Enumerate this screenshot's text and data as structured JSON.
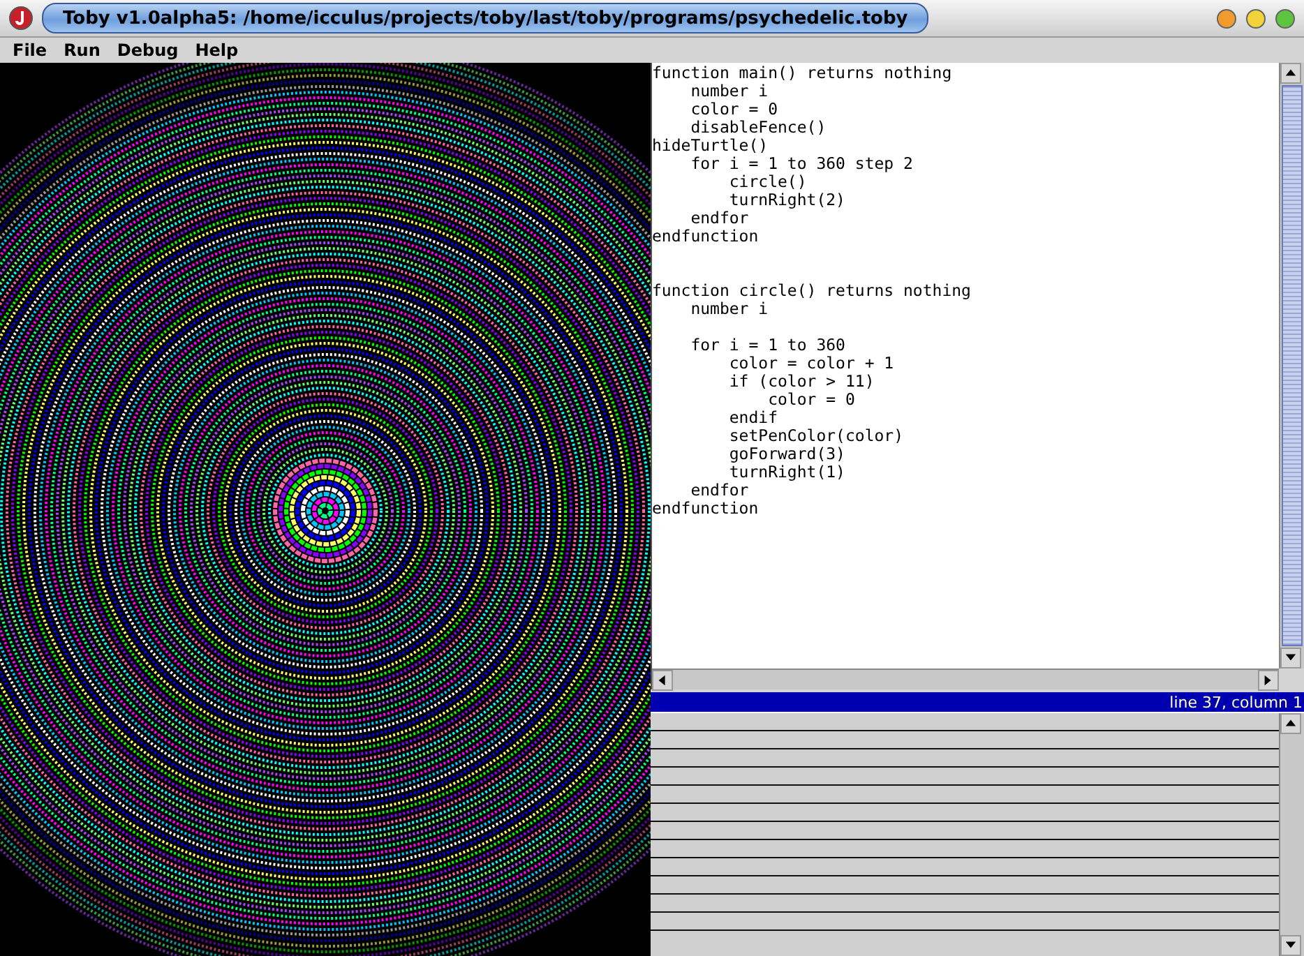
{
  "window": {
    "title": "Toby v1.0alpha5: /home/icculus/projects/toby/last/toby/programs/psychedelic.toby"
  },
  "menu": [
    "File",
    "Run",
    "Debug",
    "Help"
  ],
  "editor": {
    "lines": [
      "function main() returns nothing",
      "    number i",
      "    color = 0",
      "    disableFence()",
      "hideTurtle()",
      "    for i = 1 to 360 step 2",
      "        circle()",
      "        turnRight(2)",
      "    endfor",
      "endfunction",
      {
        "kind": "blank"
      },
      {
        "kind": "blank"
      },
      "function circle() returns nothing",
      "    number i",
      {
        "kind": "blank"
      },
      "    for i = 1 to 360",
      "        color = color + 1",
      "        if (color > 11)",
      "            color = 0",
      "        endif",
      "        setPenColor(color)",
      "        goForward(3)",
      "        turnRight(1)",
      "    endfor",
      "endfunction"
    ]
  },
  "status_bar": {
    "text": "line 37, column 1"
  }
}
